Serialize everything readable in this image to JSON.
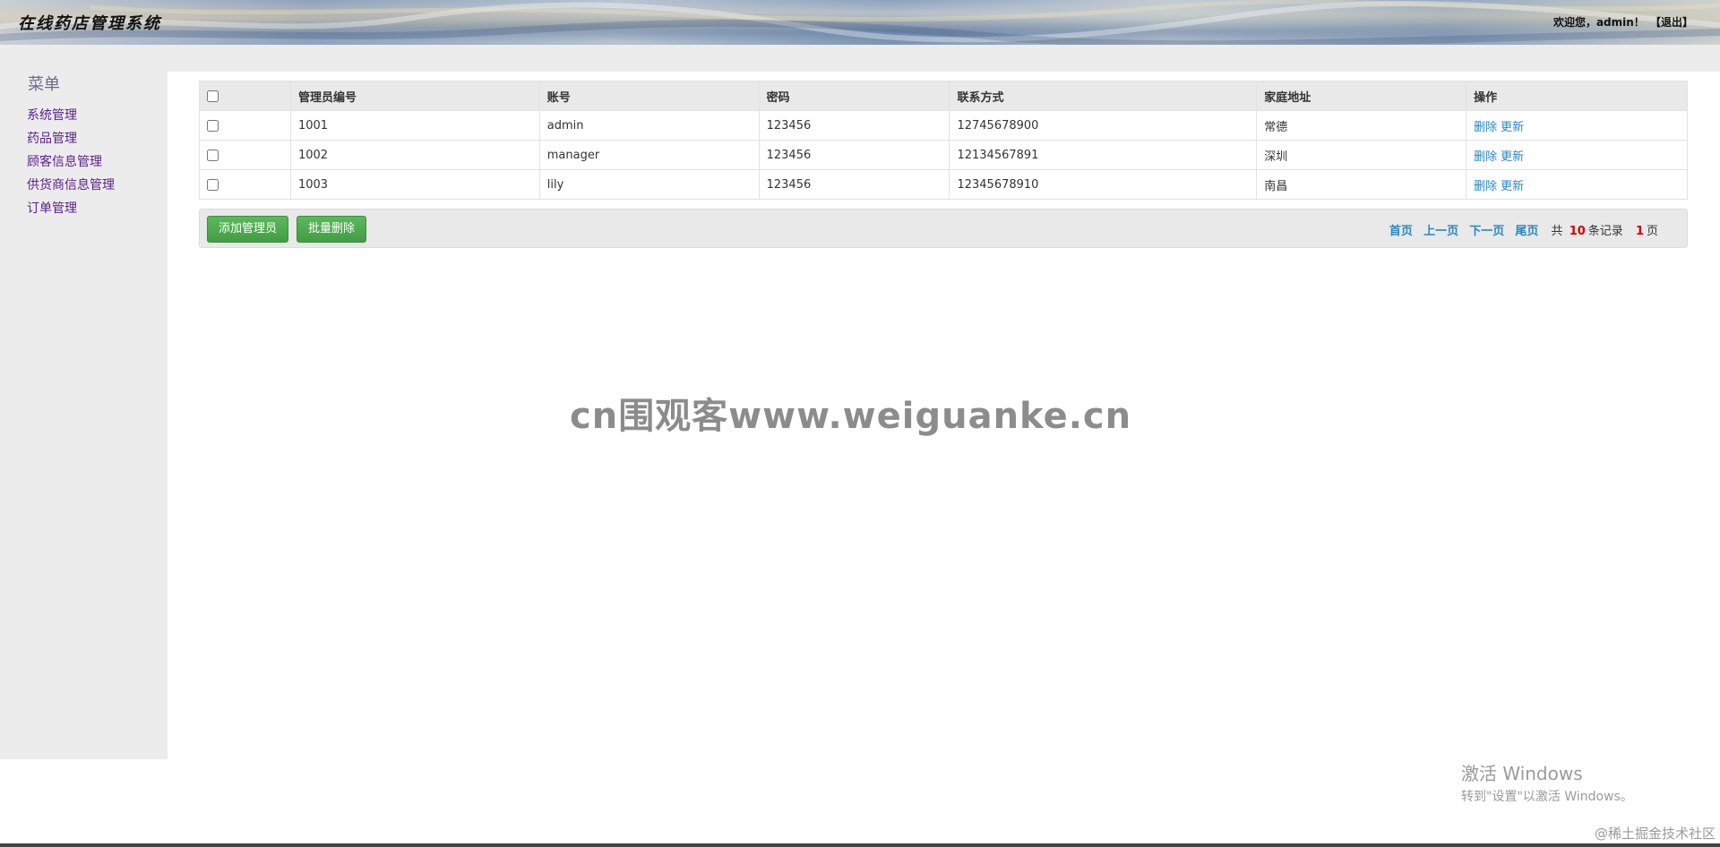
{
  "header": {
    "title": "在线药店管理系统",
    "welcome": "欢迎您，admin！",
    "logout": "【退出】"
  },
  "sidebar": {
    "title": "菜单",
    "items": [
      {
        "label": "系统管理"
      },
      {
        "label": "药品管理"
      },
      {
        "label": "顾客信息管理"
      },
      {
        "label": "供货商信息管理"
      },
      {
        "label": "订单管理"
      }
    ]
  },
  "table": {
    "headers": [
      "管理员编号",
      "账号",
      "密码",
      "联系方式",
      "家庭地址",
      "操作"
    ],
    "rows": [
      {
        "id": "1001",
        "account": "admin",
        "password": "123456",
        "phone": "12745678900",
        "address": "常德"
      },
      {
        "id": "1002",
        "account": "manager",
        "password": "123456",
        "phone": "12134567891",
        "address": "深圳"
      },
      {
        "id": "1003",
        "account": "lily",
        "password": "123456",
        "phone": "12345678910",
        "address": "南昌"
      }
    ],
    "delete_label": "删除",
    "update_label": "更新"
  },
  "toolbar": {
    "add_label": "添加管理员",
    "batch_delete_label": "批量删除"
  },
  "pager": {
    "first": "首页",
    "prev": "上一页",
    "next": "下一页",
    "last": "尾页",
    "total_prefix": "共",
    "total_records": "10",
    "records_suffix": "条记录",
    "total_pages": "1",
    "pages_suffix": "页"
  },
  "overlay": {
    "watermark": "cn围观客www.weiguanke.cn",
    "activate_title": "激活 Windows",
    "activate_sub": "转到\"设置\"以激活 Windows。",
    "credit": "@稀土掘金技术社区"
  },
  "colors": {
    "link": "#2a86c5",
    "menu_link": "#5a1f8a",
    "button_green": "#5cb85c",
    "count_red": "#d40000",
    "panel_gray": "#e9e9e9"
  }
}
